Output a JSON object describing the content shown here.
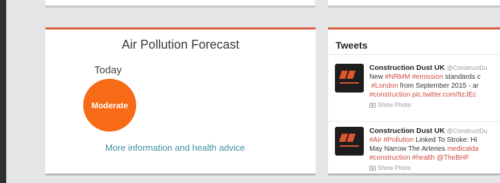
{
  "air_quality": {
    "title": "Air Pollution Forecast",
    "day": "Today",
    "level": "Moderate",
    "level_color": "#f76a16",
    "link": "More information and health advice"
  },
  "tweets_panel": {
    "title": "Tweets",
    "tweets": [
      {
        "name": "Construction Dust UK",
        "handle": "@ConstructDu",
        "line1_pre": "New ",
        "line1_tag1": "#NRMM",
        "line1_tag2": "#emission",
        "line1_post": " standards c",
        "line2_tag": "#London",
        "line2_post": " from September 2015 - ar",
        "line3": "#construction pic.twitter.com/9zJEc",
        "photo": "Show Photo"
      },
      {
        "name": "Construction Dust UK",
        "handle": "@ConstructDu",
        "line1_tag1": "#Air",
        "line1_tag2": "#Pollution",
        "line1_post": " Linked To Stroke: Hi",
        "line2_pre": "May Narrow The Arteries ",
        "line2_link": "medicalda",
        "line3": "#construction #health @TheBHF",
        "photo": "Show Photo"
      }
    ]
  },
  "colors": {
    "accent": "#d5593a",
    "hashtag": "#d04b3f",
    "link": "#3f8ea3"
  }
}
